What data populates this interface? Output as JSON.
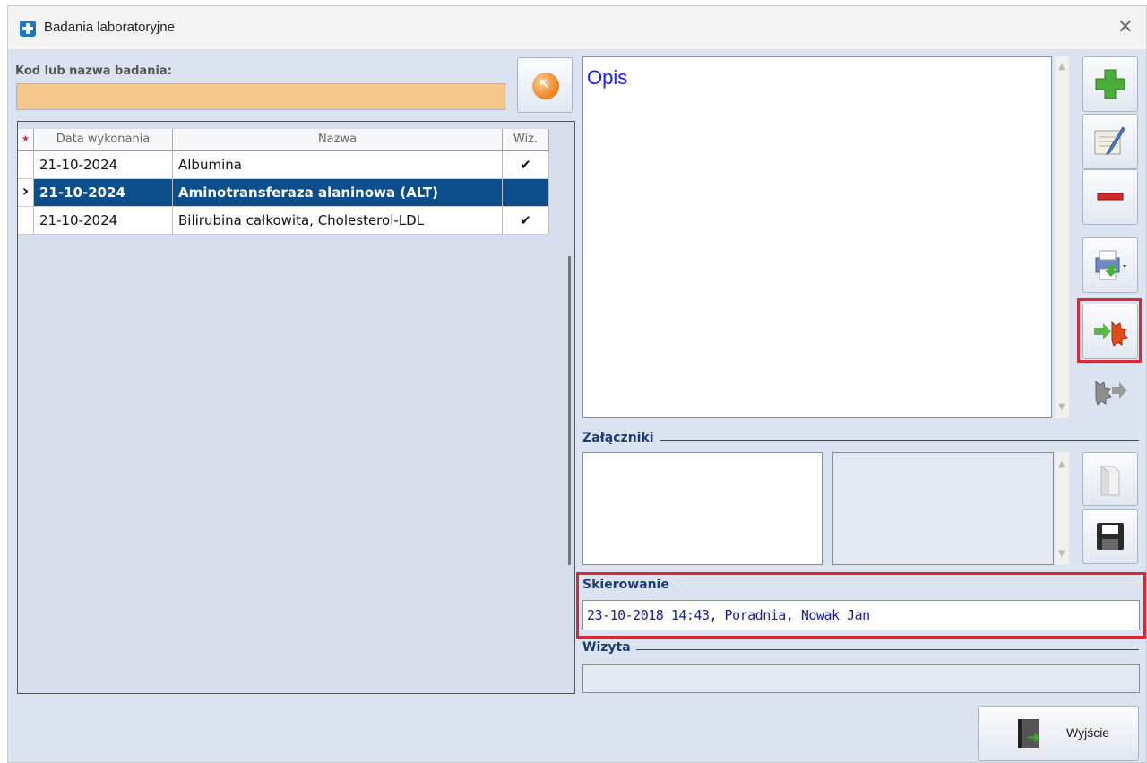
{
  "window": {
    "title": "Badania laboratoryjne",
    "close_glyph": "×"
  },
  "search": {
    "label": "Kod lub nazwa badania:",
    "value": ""
  },
  "grid": {
    "columns": {
      "star": "★",
      "date": "Data wykonania",
      "name": "Nazwa",
      "viz": "Wiz."
    },
    "rows": [
      {
        "date": "21-10-2024",
        "name": "Albumina",
        "viz": "✔",
        "selected": false
      },
      {
        "date": "21-10-2024",
        "name": "Aminotransferaza alaninowa (ALT)",
        "viz": "",
        "selected": true
      },
      {
        "date": "21-10-2024",
        "name": "Bilirubina całkowita, Cholesterol-LDL",
        "viz": "✔",
        "selected": false
      }
    ],
    "row_indicator": "›"
  },
  "opis": {
    "title": "Opis"
  },
  "attachments": {
    "label": "Załączniki"
  },
  "referral": {
    "label": "Skierowanie",
    "value": "23-10-2018 14:43, Poradnia, Nowak Jan"
  },
  "visit": {
    "label": "Wizyta",
    "value": ""
  },
  "exit_button": {
    "label": "Wyjście"
  },
  "side_buttons": [
    {
      "icon": "add-icon"
    },
    {
      "icon": "edit-icon"
    },
    {
      "icon": "remove-icon"
    },
    {
      "icon": "print-icon"
    },
    {
      "icon": "import-icon"
    },
    {
      "icon": "export-icon"
    }
  ],
  "colors": {
    "selected_row": "#0c4e8c",
    "highlight": "#d42b37",
    "search_bg": "#f5c68a"
  }
}
